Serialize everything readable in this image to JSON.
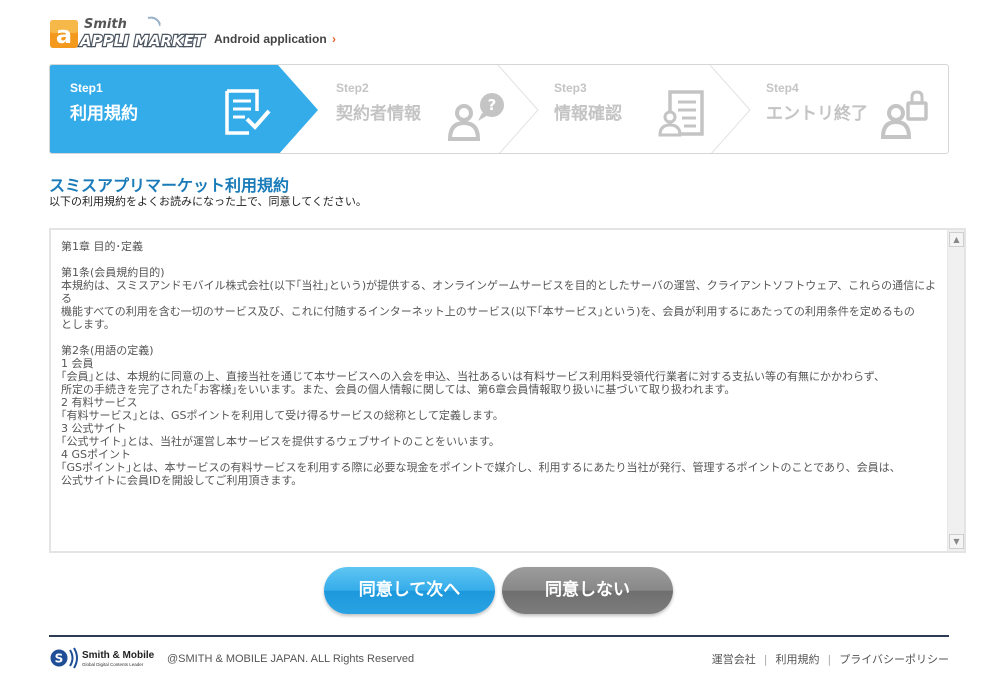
{
  "header": {
    "logo_text_top": "Smith",
    "logo_text_bottom": "APPLI MARKET",
    "subtitle": "Android application",
    "subtitle_arrow": "›"
  },
  "steps": [
    {
      "num": "Step1",
      "name": "利用規約",
      "state": "active",
      "icon": "document-check-icon"
    },
    {
      "num": "Step2",
      "name": "契約者情報",
      "state": "inactive",
      "icon": "user-question-icon"
    },
    {
      "num": "Step3",
      "name": "情報確認",
      "state": "inactive",
      "icon": "user-document-icon"
    },
    {
      "num": "Step4",
      "name": "エントリ終了",
      "state": "inactive",
      "icon": "user-lock-icon"
    }
  ],
  "main": {
    "title": "スミスアプリマーケット利用規約",
    "subtitle": "以下の利用規約をよくお読みになった上で、同意してください。"
  },
  "terms": {
    "chapter": "第1章 目的･定義",
    "article1_title": "第1条(会員規約目的)",
    "article1_body": "本規約は、スミスアンドモバイル株式会社(以下｢当社｣という)が提供する、オンラインゲームサービスを目的としたサーバの運営、クライアントソフトウェア、これらの通信による\n機能すべての利用を含む一切のサービス及び、これに付随するインターネット上のサービス(以下｢本サービス｣という)を、会員が利用するにあたっての利用条件を定めるもの\nとします。",
    "article2_title": "第2条(用語の定義)",
    "def1_title": "1 会員",
    "def1_body": "｢会員｣とは、本規約に同意の上、直接当社を通じて本サービスへの入会を申込、当社あるいは有料サービス利用料受領代行業者に対する支払い等の有無にかかわらず、\n所定の手続きを完了された｢お客様｣をいいます。また、会員の個人情報に関しては、第6章会員情報取り扱いに基づいて取り扱われます。",
    "def2_title": "2 有料サービス",
    "def2_body": "｢有料サービス｣とは、GSポイントを利用して受け得るサービスの総称として定義します。",
    "def3_title": "3 公式サイト",
    "def3_body": "｢公式サイト｣とは、当社が運営し本サービスを提供するウェブサイトのことをいいます。",
    "def4_title": "4 GSポイント",
    "def4_body": "｢GSポイント｣とは、本サービスの有料サービスを利用する際に必要な現金をポイントで媒介し、利用するにあたり当社が発行、管理するポイントのことであり、会員は、\n公式サイトに会員IDを開設してご利用頂きます。"
  },
  "buttons": {
    "agree": "同意して次へ",
    "disagree": "同意しない"
  },
  "footer": {
    "logo_text": "Smith & Mobile",
    "logo_tagline": "Global Digital Contents Leader",
    "copyright": "@SMITH & MOBILE JAPAN. ALL Rights Reserved",
    "links": [
      "運営会社",
      "利用規約",
      "プライバシーポリシー"
    ]
  },
  "colors": {
    "accent": "#35acea",
    "title": "#1a7bb9",
    "inactive": "#c4c4c4",
    "footer_line": "#2d3b55"
  }
}
